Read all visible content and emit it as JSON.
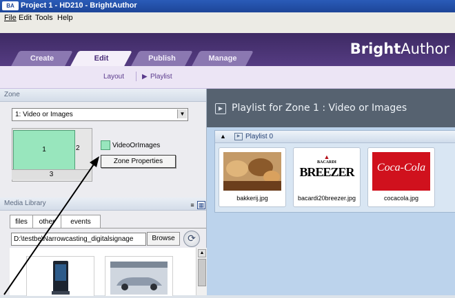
{
  "window": {
    "title": "Project 1 - HD210 - BrightAuthor",
    "icon_text": "BA"
  },
  "menu": [
    {
      "label": "File",
      "underline": "F"
    },
    {
      "label": "Edit",
      "underline": "E"
    },
    {
      "label": "Tools",
      "underline": "T"
    },
    {
      "label": "Help",
      "underline": "H"
    }
  ],
  "tabs": [
    {
      "label": "Create",
      "active": false
    },
    {
      "label": "Edit",
      "active": true
    },
    {
      "label": "Publish",
      "active": false
    },
    {
      "label": "Manage",
      "active": false
    }
  ],
  "brand": {
    "bold": "Bright",
    "light": "Author"
  },
  "subnav": {
    "layout": "Layout",
    "playlist": "Playlist",
    "playlist_icon": "play-triangle-icon"
  },
  "zone_panel": {
    "header": "Zone",
    "selected_zone": "1: Video or Images",
    "zones": [
      "1",
      "2",
      "3"
    ],
    "zone_type": "VideoOrImages",
    "zone_color": "#98e6bd",
    "properties_button": "Zone Properties"
  },
  "media_library": {
    "header": "Media Library",
    "tabs": [
      "files",
      "other",
      "events"
    ],
    "path": "D:\\testbe\\Narrowcasting_digitalsignage",
    "browse_label": "Browse",
    "refresh_icon": "refresh-icon"
  },
  "playlist": {
    "header": "Playlist for Zone 1 : Video or Images",
    "name": "Playlist 0",
    "items": [
      {
        "file": "bakkerij.jpg"
      },
      {
        "file": "bacardi20breezer.jpg",
        "logo_top": "BACARDI",
        "logo_main": "BREEZER"
      },
      {
        "file": "cocacola.jpg",
        "logo_main": "Coca-Cola"
      }
    ]
  },
  "colors": {
    "accent_purple": "#553c82",
    "panel_header": "#566270",
    "playlist_bg": "#bcd3ec"
  }
}
